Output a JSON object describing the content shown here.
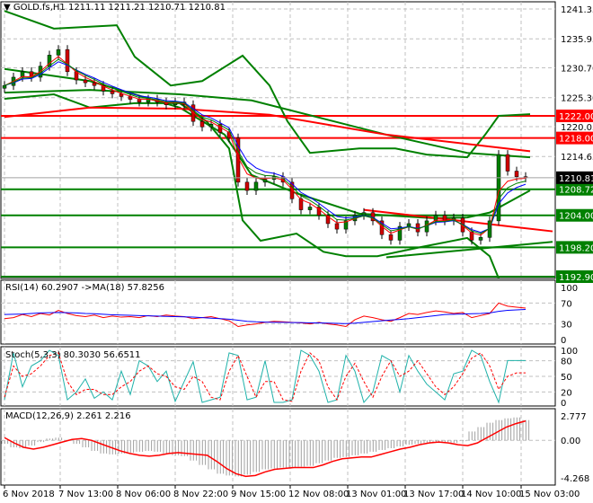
{
  "chart_data": [
    {
      "type": "candlestick",
      "title": "GOLD.fs,H1",
      "ohlc_readout": [
        "1211.11",
        "1211.21",
        "1210.71",
        "1210.81"
      ],
      "ylim": [
        1192.9,
        1241.35
      ],
      "y_ticks": [
        "1241.35",
        "1235.95",
        "1230.70",
        "1225.30",
        "1220.05",
        "1214.65"
      ],
      "grid": true,
      "current_price": "1210.81",
      "closes": [
        1227.5,
        1229,
        1230,
        1229,
        1231,
        1233,
        1234,
        1230,
        1228.5,
        1228,
        1227.5,
        1226.5,
        1226,
        1225.5,
        1225,
        1224.5,
        1225,
        1224.5,
        1224,
        1224.5,
        1224,
        1221,
        1220,
        1220.5,
        1219,
        1218,
        1210,
        1208.5,
        1210,
        1210.5,
        1211,
        1210,
        1207,
        1205,
        1205.5,
        1204,
        1202.5,
        1201.5,
        1203,
        1204,
        1204.5,
        1203,
        1200.5,
        1199.5,
        1202,
        1202.5,
        1201,
        1203,
        1204,
        1203,
        1203.5,
        1201,
        1199.5,
        1200,
        1203,
        1215,
        1212,
        1211,
        1210.8
      ],
      "levels": [
        {
          "value": 1222.0,
          "label": "1222.00",
          "color": "#ff0000"
        },
        {
          "value": 1218.0,
          "label": "1218.00",
          "color": "#ff0000"
        },
        {
          "value": 1208.72,
          "label": "1208.72",
          "color": "#008000"
        },
        {
          "value": 1204.0,
          "label": "1204.00",
          "color": "#008000"
        },
        {
          "value": 1198.2,
          "label": "1198.20",
          "color": "#008000"
        },
        {
          "value": 1192.9,
          "label": "1192.90",
          "color": "#008000"
        }
      ],
      "lines": [
        {
          "color": "#008000",
          "points": [
            [
              0,
              1241.0
            ],
            [
              5.5,
              1237.8
            ],
            [
              12.5,
              1238.4
            ],
            [
              14.5,
              1232.7
            ],
            [
              18.5,
              1227.5
            ],
            [
              22,
              1228.3
            ],
            [
              26.5,
              1232.9
            ],
            [
              29.5,
              1227.5
            ],
            [
              31.5,
              1221.0
            ],
            [
              34,
              1215.3
            ],
            [
              39.5,
              1216.1
            ],
            [
              43.5,
              1216.1
            ],
            [
              47,
              1215.0
            ],
            [
              51.5,
              1214.5
            ],
            [
              53.5,
              1218.6
            ],
            [
              55,
              1222
            ],
            [
              58.5,
              1222.3
            ]
          ]
        },
        {
          "color": "#008000",
          "points": [
            [
              0,
              1225.1
            ],
            [
              5.5,
              1225.9
            ],
            [
              9.5,
              1223.5
            ],
            [
              14.5,
              1224.3
            ],
            [
              19.5,
              1224.3
            ],
            [
              22.5,
              1221.0
            ],
            [
              25,
              1216.1
            ],
            [
              26.5,
              1203.1
            ],
            [
              28.5,
              1199.4
            ],
            [
              32.5,
              1200.7
            ],
            [
              35.5,
              1197.4
            ],
            [
              38,
              1196.6
            ],
            [
              41.5,
              1196.6
            ],
            [
              46.5,
              1198.3
            ],
            [
              51.5,
              1199.9
            ],
            [
              54,
              1196.6
            ],
            [
              55,
              1192.6
            ]
          ]
        },
        {
          "color": "#008000",
          "points": [
            [
              0,
              1230.5
            ],
            [
              9.5,
              1228.3
            ],
            [
              19.5,
              1223.5
            ],
            [
              24.5,
              1218.6
            ],
            [
              27.5,
              1211.3
            ],
            [
              32.5,
              1208.0
            ],
            [
              39.5,
              1204.3
            ],
            [
              47.5,
              1203.5
            ],
            [
              51.5,
              1203.6
            ],
            [
              54,
              1204.5
            ],
            [
              58.5,
              1208.5
            ]
          ]
        },
        {
          "color": "#008000",
          "points": [
            [
              0,
              1226.2
            ],
            [
              9.5,
              1226.7
            ],
            [
              19.5,
              1225.9
            ],
            [
              27.5,
              1224.8
            ],
            [
              42.5,
              1218.6
            ],
            [
              51.5,
              1215.3
            ],
            [
              58.5,
              1214.5
            ]
          ]
        },
        {
          "color": "#ff0000",
          "points": [
            [
              0,
              1221.8
            ],
            [
              9.5,
              1223.5
            ],
            [
              19.5,
              1223.3
            ],
            [
              29.5,
              1222.2
            ],
            [
              42.5,
              1218.6
            ],
            [
              58.5,
              1215.6
            ]
          ]
        },
        {
          "color": "#ff0000",
          "points": [
            [
              40,
              1205
            ],
            [
              61,
              1201.1
            ]
          ]
        },
        {
          "color": "#008000",
          "points": [
            [
              42.5,
              1196.4
            ],
            [
              61,
              1199.2
            ]
          ]
        }
      ]
    },
    {
      "type": "line",
      "title": "RSI(14) 60.2907  ->MA(18) 57.8256",
      "ylim": [
        0,
        100
      ],
      "y_ticks": [
        "100",
        "70",
        "30",
        "0"
      ],
      "series": [
        {
          "color": "#ff0000",
          "values": [
            40,
            42,
            48,
            44,
            50,
            47,
            56,
            50,
            46,
            44,
            47,
            42,
            45,
            43,
            44,
            42,
            46,
            44,
            47,
            45,
            44,
            40,
            42,
            44,
            40,
            36,
            25,
            28,
            30,
            33,
            35,
            34,
            33,
            32,
            30,
            33,
            30,
            28,
            25,
            38,
            45,
            42,
            38,
            35,
            42,
            50,
            48,
            52,
            55,
            53,
            50,
            52,
            42,
            46,
            50,
            70,
            64,
            62,
            60.3
          ]
        },
        {
          "color": "#0000ff",
          "values": [
            48,
            48.5,
            49,
            50,
            51,
            51.5,
            52,
            51.5,
            51,
            50,
            49.5,
            48.5,
            47.5,
            47,
            46.5,
            46,
            45.5,
            45,
            44.5,
            44,
            43.5,
            43,
            42,
            41,
            40,
            39,
            37,
            35,
            34,
            33.5,
            33,
            33,
            32.5,
            32.5,
            32,
            32,
            31.5,
            31,
            30.5,
            31.5,
            33,
            34.5,
            36,
            37.5,
            38.5,
            40,
            42,
            44,
            46,
            48,
            48.5,
            49,
            49.5,
            50,
            51,
            54,
            56,
            57,
            57.8
          ]
        }
      ]
    },
    {
      "type": "line",
      "title": "Stoch(5,3,3) 80.3030 56.6511",
      "ylim": [
        0,
        100
      ],
      "y_ticks": [
        "100",
        "80",
        "50",
        "20",
        "0"
      ],
      "series": [
        {
          "color": "#20b2aa",
          "values": [
            5,
            95,
            30,
            70,
            80,
            100,
            90,
            5,
            20,
            45,
            8,
            20,
            5,
            60,
            15,
            80,
            70,
            40,
            60,
            2,
            40,
            78,
            0,
            5,
            10,
            95,
            90,
            5,
            10,
            80,
            0,
            0,
            5,
            100,
            90,
            60,
            0,
            5,
            90,
            60,
            0,
            20,
            90,
            80,
            20,
            90,
            60,
            35,
            20,
            5,
            55,
            60,
            100,
            90,
            40,
            0,
            80.3,
            80.3,
            80.3
          ]
        },
        {
          "color": "#ff0000",
          "values": [
            10,
            70,
            50,
            55,
            70,
            90,
            95,
            40,
            15,
            25,
            25,
            15,
            15,
            30,
            40,
            60,
            70,
            55,
            50,
            30,
            25,
            50,
            40,
            10,
            5,
            60,
            90,
            50,
            10,
            40,
            40,
            5,
            2,
            60,
            95,
            80,
            30,
            5,
            50,
            75,
            40,
            10,
            50,
            80,
            50,
            60,
            80,
            55,
            30,
            15,
            30,
            55,
            85,
            95,
            70,
            25,
            50,
            56.7,
            56.7
          ]
        }
      ]
    },
    {
      "type": "bar",
      "title": "MACD(12,26,9) 2.261 2.216",
      "ylim": [
        -4.268,
        2.777
      ],
      "y_ticks": [
        "2.777",
        "0.00",
        "-4.268"
      ],
      "histogram": {
        "color": "#a0a0a0",
        "values": [
          -0.4,
          -0.8,
          -0.9,
          -0.6,
          -0.2,
          0.2,
          0.3,
          0,
          -0.4,
          -0.8,
          -1.2,
          -1.5,
          -1.6,
          -1.5,
          -1.4,
          -1.3,
          -1.2,
          -1.3,
          -1.5,
          -1.7,
          -1.8,
          -2.3,
          -2.8,
          -3.3,
          -3.8,
          -4.0,
          -4.1,
          -3.9,
          -3.6,
          -3.3,
          -3.2,
          -3.1,
          -3.1,
          -3.0,
          -2.9,
          -2.6,
          -2.3,
          -2.0,
          -1.9,
          -1.7,
          -1.5,
          -1.3,
          -1.1,
          -0.9,
          -0.7,
          -0.5,
          -0.4,
          -0.3,
          -0.2,
          -0.2,
          -0.3,
          -0.1,
          1.0,
          1.5,
          2.0,
          2.3,
          2.5,
          2.6,
          2.3
        ]
      },
      "signal": {
        "color": "#ff0000",
        "values": [
          0.3,
          -0.3,
          -0.8,
          -1.0,
          -0.8,
          -0.5,
          -0.2,
          0.1,
          0.2,
          0,
          -0.4,
          -0.8,
          -1.2,
          -1.5,
          -1.7,
          -1.8,
          -1.7,
          -1.5,
          -1.4,
          -1.5,
          -1.6,
          -1.7,
          -2.4,
          -3.2,
          -3.8,
          -4.1,
          -4.0,
          -3.6,
          -3.3,
          -3.2,
          -3.1,
          -3.1,
          -3.1,
          -2.8,
          -2.4,
          -2.1,
          -2.0,
          -1.9,
          -1.9,
          -1.6,
          -1.3,
          -1.0,
          -0.8,
          -0.5,
          -0.3,
          -0.2,
          -0.3,
          -0.5,
          -0.6,
          -0.3,
          0.3,
          0.9,
          1.5,
          1.9,
          2.2
        ]
      }
    }
  ],
  "x_axis": {
    "labels": [
      "6 Nov 2018",
      "7 Nov 13:00",
      "8 Nov 06:00",
      "8 Nov 22:00",
      "9 Nov 15:00",
      "12 Nov 08:00",
      "13 Nov 01:00",
      "13 Nov 17:00",
      "14 Nov 10:00",
      "15 Nov 03:00"
    ],
    "positions": [
      0,
      6.2,
      12.6,
      19,
      25.4,
      31.8,
      38.2,
      44.6,
      51,
      57.5
    ]
  }
}
